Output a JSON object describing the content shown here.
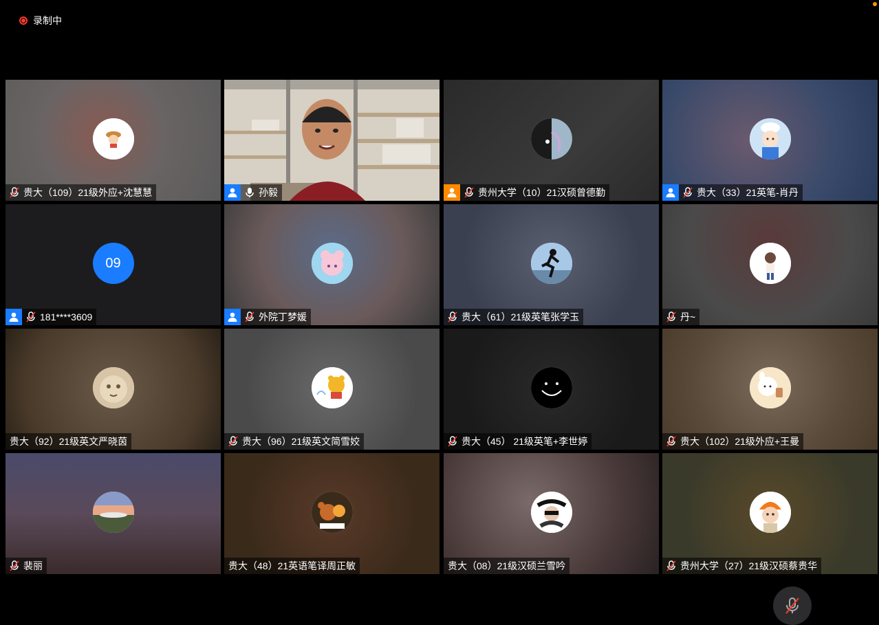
{
  "recording": {
    "label": "录制中",
    "color": "#ff3b30"
  },
  "tiles": [
    {
      "name": "贵大（109）21级外应+沈慧慧",
      "muted": true,
      "host": false,
      "bg": "radial-gradient(circle at 45% 45%, #8a5a52 0%, #6a6464 45%, #5a5a5a 100%)",
      "avatar": "cartoon-girl-hat"
    },
    {
      "name": "孙毅",
      "muted": false,
      "host": true,
      "speaking": true,
      "video": true,
      "bg": "#c9c1b4"
    },
    {
      "name": "贵州大学（10）21汉硕曾德勤",
      "muted": true,
      "host": true,
      "host_color": "#ff8a00",
      "bg": "linear-gradient(135deg,#2a2a2a,#3a3a3a 60%,#2a2a2a)",
      "avatar": "half-moon"
    },
    {
      "name": "贵大（33）21英笔-肖丹",
      "muted": true,
      "host": true,
      "bg": "radial-gradient(circle at 40% 50%, #6a5a6e, #3a4a6a 60%, #2a3a5a)",
      "avatar": "cartoon-chef"
    },
    {
      "name": "181****3609",
      "muted": true,
      "host": true,
      "bg": "#1c1c1e",
      "number_avatar": "09"
    },
    {
      "name": "外院丁梦媛",
      "muted": true,
      "host": true,
      "bg": "radial-gradient(circle at 50% 40%, #5a6c8a, #6a5a5a 55%, #3a3a3a)",
      "avatar": "anime-girl"
    },
    {
      "name": "贵大（61）21级英笔张学玉",
      "muted": true,
      "host": false,
      "bg": "radial-gradient(circle at 50% 45%, #5a6070, #3a4050 70%)",
      "avatar": "silhouette-runner"
    },
    {
      "name": "丹~",
      "muted": true,
      "host": false,
      "bg": "radial-gradient(circle at 50% 30%, #5a3a3a, #4a4a4a 60%, #3a3a3a)",
      "avatar": "cartoon-kid"
    },
    {
      "name": "贵大（92）21级英文严晓茵",
      "muted": false,
      "host": false,
      "bg": "radial-gradient(circle at 50% 50%, #6a5a4a, #4a3a2a 70%, #2a2218)",
      "avatar": "cat-face"
    },
    {
      "name": "贵大（96）21级英文简雪姣",
      "muted": true,
      "host": false,
      "bg": "radial-gradient(circle at 50% 50%, #6a6a6a, #4a4a4a 70%)",
      "avatar": "winnie-pooh"
    },
    {
      "name": "贵大（45） 21级英笔+李世婷",
      "muted": true,
      "host": false,
      "bg": "radial-gradient(circle at 50% 50%, #2a2a2a, #1a1a1a 70%)",
      "avatar": "smiley-dark"
    },
    {
      "name": "贵大（102）21级外应+王曼",
      "muted": true,
      "host": false,
      "bg": "radial-gradient(circle at 50% 45%, #7a6a5a, #5a4a3a 60%, #4a3a2a)",
      "avatar": "cartoon-rabbit"
    },
    {
      "name": "裴丽",
      "muted": true,
      "host": false,
      "bg": "linear-gradient(180deg,#4a4a6a,#5a4a5a 50%,#3a2a2a)",
      "avatar": "sunset-landscape"
    },
    {
      "name": "贵大（48）21英语笔译周正敏",
      "muted": false,
      "host": false,
      "bg": "radial-gradient(circle at 50% 50%, #5a3a2a, #3a2a1a 70%)",
      "avatar": "cartoon-mouse"
    },
    {
      "name": "贵大（08）21级汉硕兰雪吟",
      "muted": false,
      "host": false,
      "bg": "radial-gradient(circle at 40% 40%, #7a6a6a, #4a3a3a 60%, #2a2222)",
      "avatar": "girl-sunglasses"
    },
    {
      "name": "贵州大学（27）21级汉硕蔡贵华",
      "muted": true,
      "host": false,
      "bg": "radial-gradient(circle at 50% 50%, #5a4a2a, #3a3a2a 70%)",
      "avatar": "child-helmet"
    }
  ],
  "icons": {
    "mic_muted": "mic-muted-icon",
    "mic": "mic-icon",
    "host": "person-icon"
  },
  "colors": {
    "host_badge": "#1a7cff",
    "speaking_border": "#2ecc40",
    "orange_dot": "#ff9500"
  }
}
